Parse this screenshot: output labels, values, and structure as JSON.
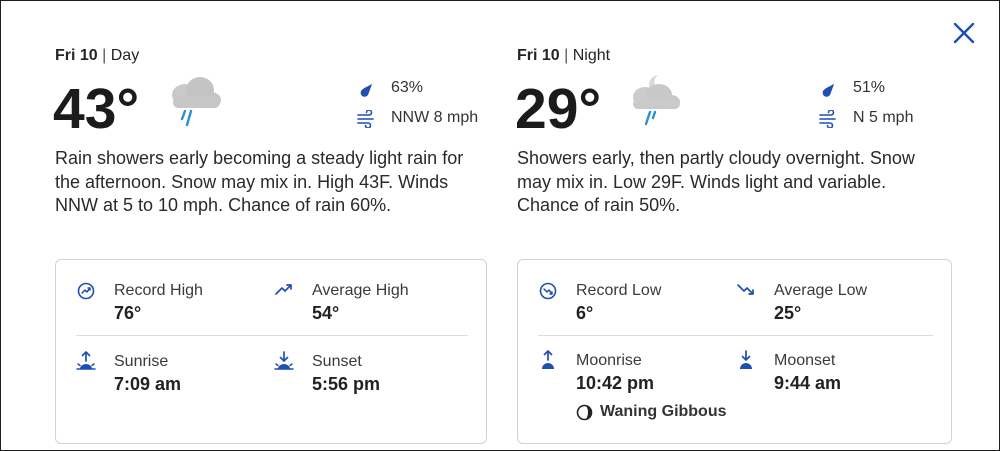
{
  "colors": {
    "accent": "#1f4fb0",
    "icon_blue": "#2a5bd7",
    "text": "#252525",
    "card_border": "#d2d2d2"
  },
  "close": {
    "icon": "close-icon"
  },
  "day": {
    "date": "Fri 10",
    "separator": "|",
    "period": "Day",
    "temperature": "43°",
    "condition_icon": "rain-showers-cloud-icon",
    "precip": "63%",
    "wind": "NNW 8 mph",
    "description": "Rain showers early becoming a steady light rain for the afternoon. Snow may mix in. High 43F. Winds NNW at 5 to 10 mph. Chance of rain 60%.",
    "details": {
      "record_label": "Record High",
      "record_value": "76°",
      "average_label": "Average High",
      "average_value": "54°",
      "rise_label": "Sunrise",
      "rise_value": "7:09 am",
      "set_label": "Sunset",
      "set_value": "5:56 pm"
    }
  },
  "night": {
    "date": "Fri 10",
    "separator": "|",
    "period": "Night",
    "temperature": "29°",
    "condition_icon": "night-showers-cloud-icon",
    "precip": "51%",
    "wind": "N 5 mph",
    "description": "Showers early, then partly cloudy overnight. Snow may mix in. Low 29F. Winds light and variable. Chance of rain 50%.",
    "details": {
      "record_label": "Record Low",
      "record_value": "6°",
      "average_label": "Average Low",
      "average_value": "25°",
      "rise_label": "Moonrise",
      "rise_value": "10:42 pm",
      "set_label": "Moonset",
      "set_value": "9:44 am",
      "moon_phase": "Waning Gibbous"
    }
  }
}
